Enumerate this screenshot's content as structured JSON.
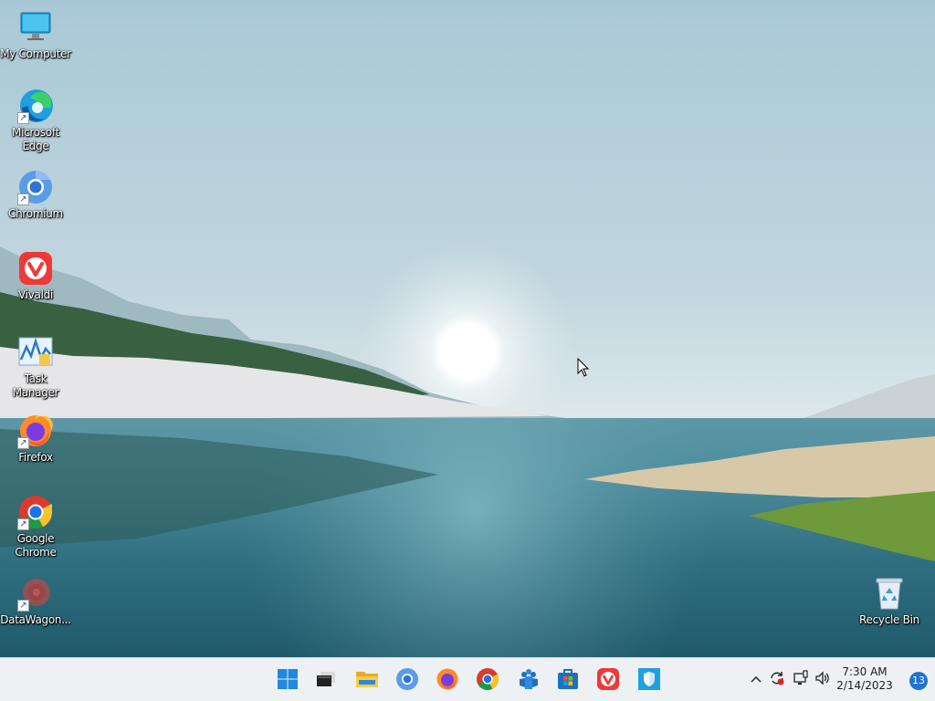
{
  "desktop": {
    "icons": [
      {
        "label": "My Computer",
        "icon": "monitor-icon"
      },
      {
        "label": "Microsoft Edge",
        "icon": "edge-icon"
      },
      {
        "label": "Chromium",
        "icon": "chromium-icon"
      },
      {
        "label": "Vivaldi",
        "icon": "vivaldi-icon"
      },
      {
        "label": "Task Manager",
        "icon": "task-manager-icon"
      },
      {
        "label": "Firefox",
        "icon": "firefox-icon"
      },
      {
        "label": "Google Chrome",
        "icon": "chrome-icon"
      },
      {
        "label": "DataWagon...",
        "icon": "datawagon-icon"
      },
      {
        "label": "Recycle Bin",
        "icon": "recycle-bin-icon"
      }
    ]
  },
  "taskbar": {
    "apps": [
      "start-icon",
      "terminal-icon",
      "file-explorer-icon",
      "chromium-icon",
      "firefox-icon",
      "chrome-icon",
      "teams-icon",
      "store-icon",
      "vivaldi-icon",
      "defender-icon"
    ],
    "clock": {
      "time": "7:30 AM",
      "date": "2/14/2023"
    },
    "notification_count": "13"
  },
  "colors": {
    "taskbar_bg": "#eef1f4",
    "accent": "#1f74d0"
  }
}
